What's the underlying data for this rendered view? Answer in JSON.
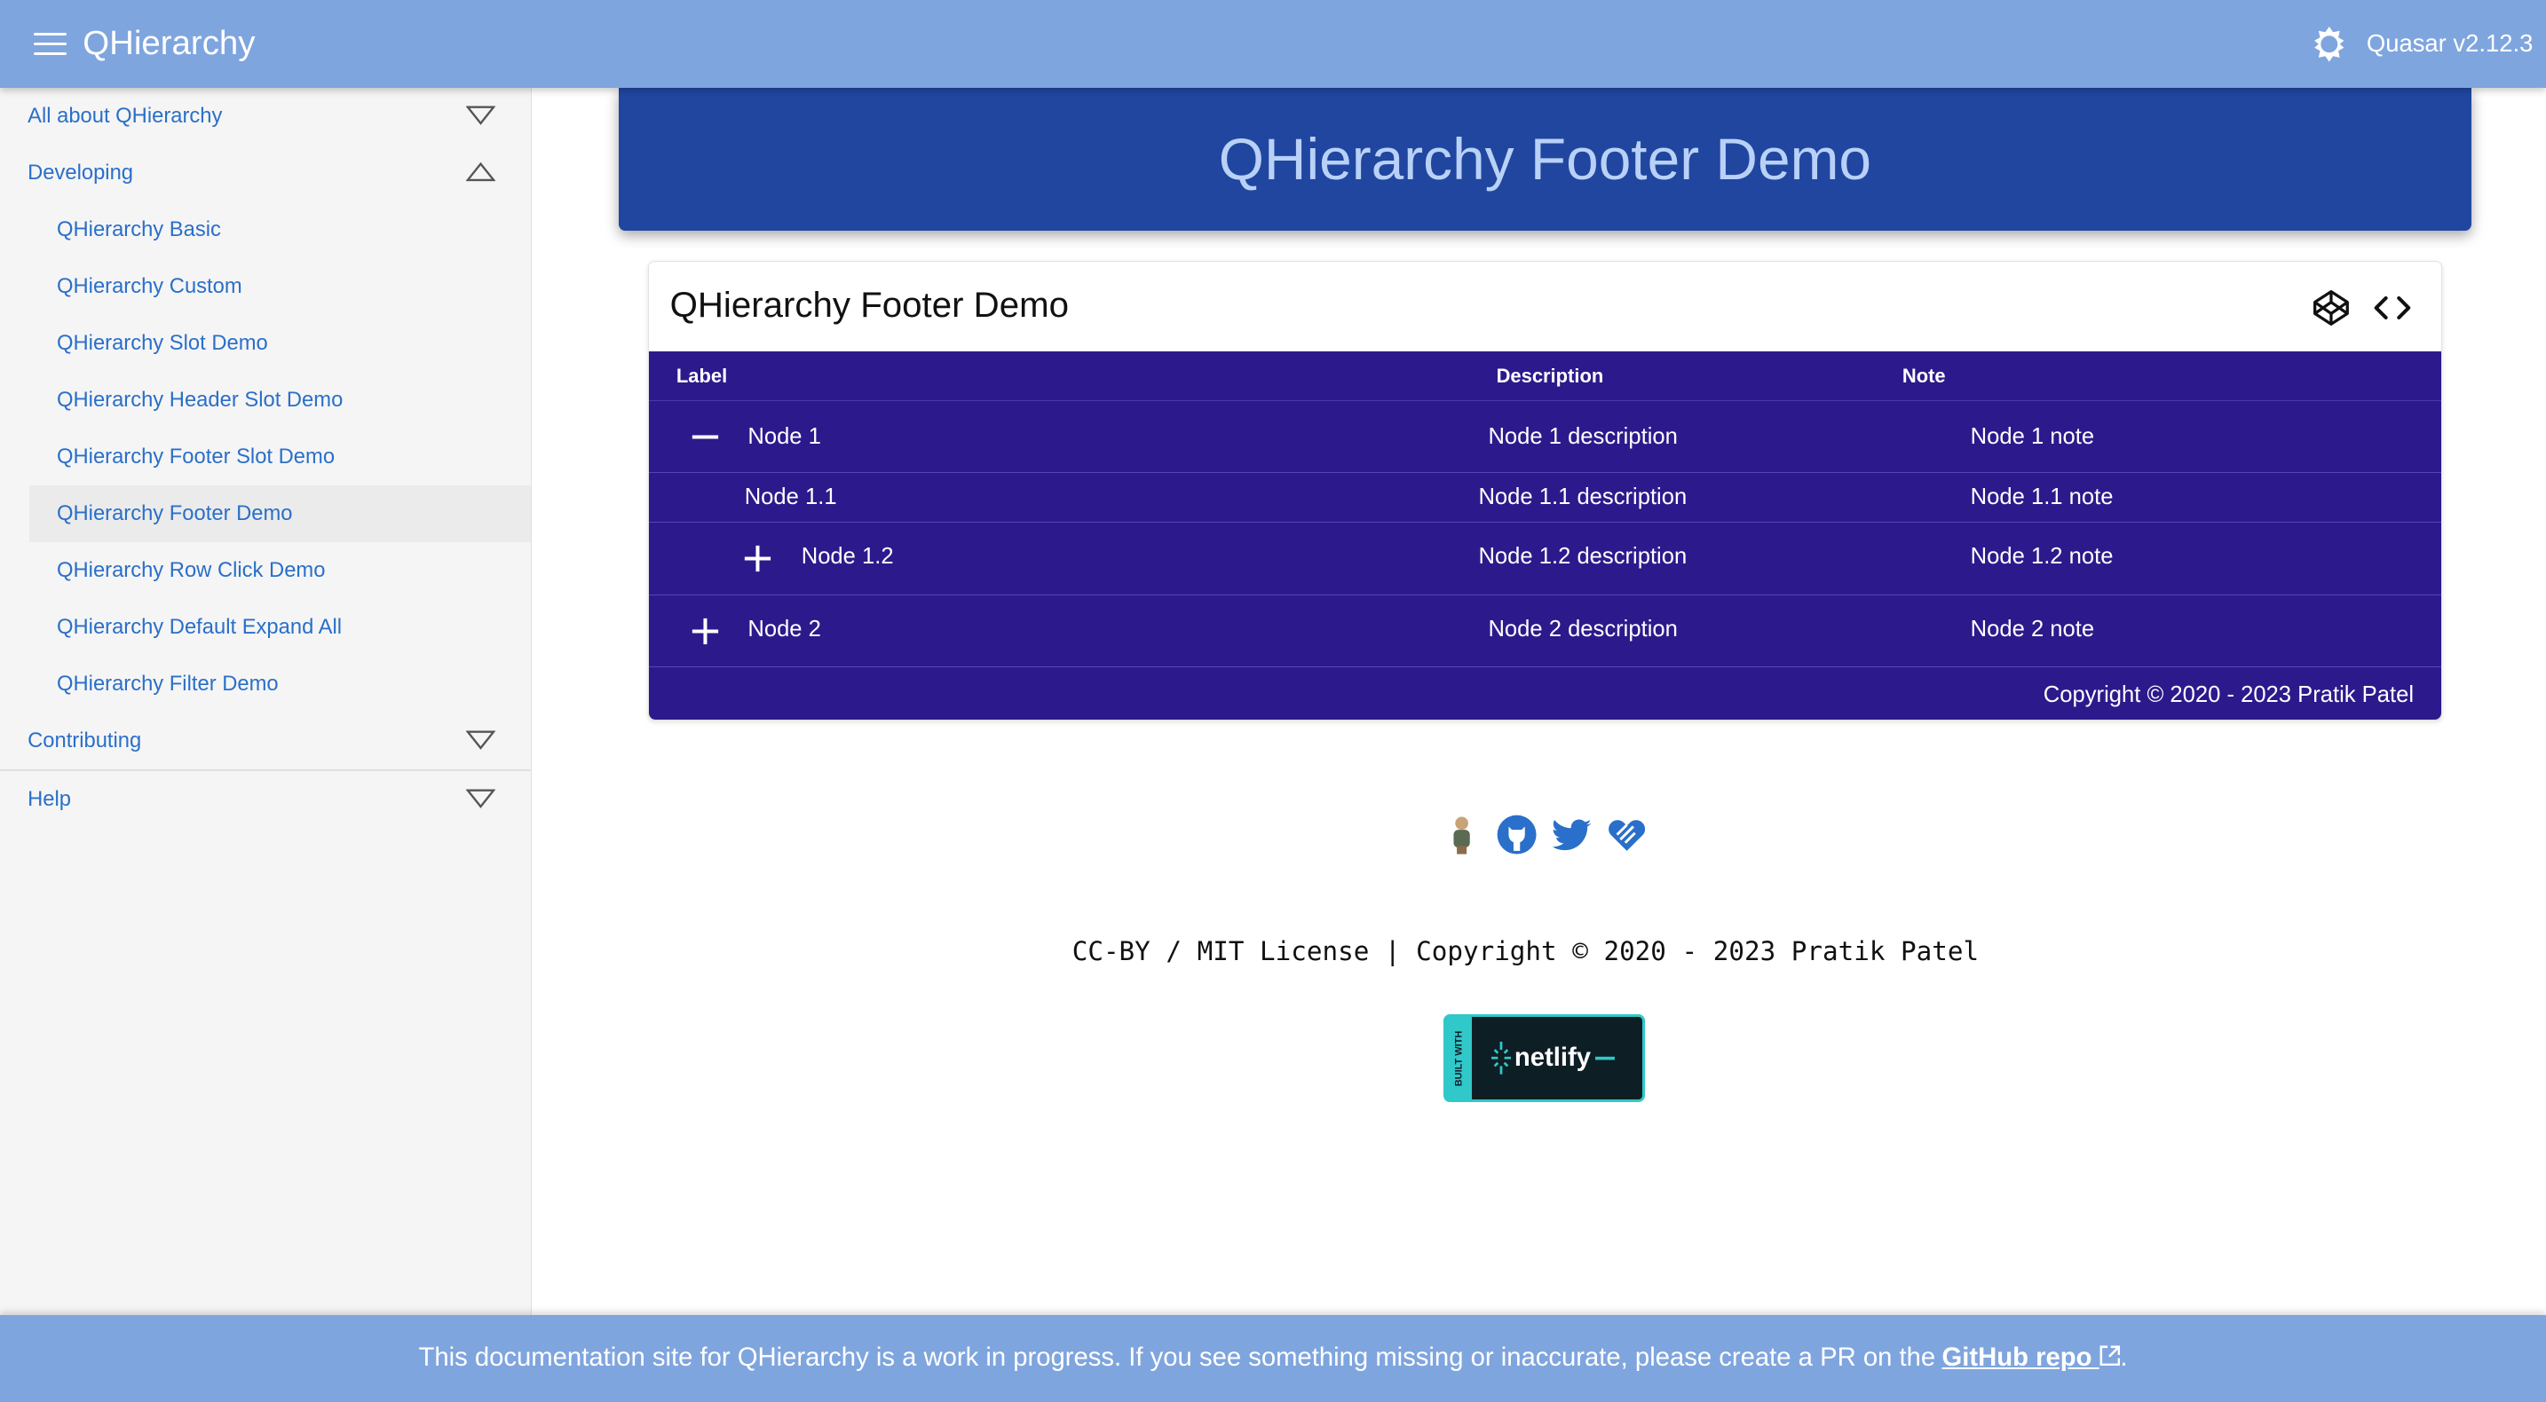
{
  "header": {
    "title": "QHierarchy",
    "version": "Quasar v2.12.3"
  },
  "sidebar": {
    "groups": [
      {
        "label": "All about QHierarchy",
        "expanded": false
      },
      {
        "label": "Developing",
        "expanded": true
      },
      {
        "label": "Contributing",
        "expanded": false
      },
      {
        "label": "Help",
        "expanded": false
      }
    ],
    "sub_items": [
      "QHierarchy Basic",
      "QHierarchy Custom",
      "QHierarchy Slot Demo",
      "QHierarchy Header Slot Demo",
      "QHierarchy Footer Slot Demo",
      "QHierarchy Footer Demo",
      "QHierarchy Row Click Demo",
      "QHierarchy Default Expand All",
      "QHierarchy Filter Demo"
    ],
    "active": "QHierarchy Footer Demo"
  },
  "banner": {
    "title": "QHierarchy Footer Demo"
  },
  "card": {
    "title": "QHierarchy Footer Demo",
    "columns": [
      "Label",
      "Description",
      "Note"
    ],
    "rows": [
      {
        "label": "Node 1",
        "description": "Node 1 description",
        "note": "Node 1 note",
        "toggle": "minus"
      },
      {
        "label": "Node 1.1",
        "description": "Node 1.1 description",
        "note": "Node 1.1 note",
        "toggle": ""
      },
      {
        "label": "Node 1.2",
        "description": "Node 1.2 description",
        "note": "Node 1.2 note",
        "toggle": "plus"
      },
      {
        "label": "Node 2",
        "description": "Node 2 description",
        "note": "Node 2 note",
        "toggle": "plus"
      }
    ],
    "footer": "Copyright © 2020 - 2023 Pratik Patel"
  },
  "footer": {
    "social_icons": [
      "avatar-icon",
      "github-icon",
      "twitter-icon",
      "sponsor-icon"
    ],
    "license": "CC-BY / MIT License | Copyright © 2020 - 2023 Pratik Patel",
    "netlify_built": "BUILT WITH",
    "netlify_word": "netlify"
  },
  "notice": {
    "text": "This documentation site for QHierarchy is a work in progress. If you see something missing or inaccurate, please create a PR on the",
    "link": "GitHub repo",
    "end": "."
  },
  "colors": {
    "topbar": "#7fa5de",
    "banner": "#2046a0",
    "table": "#2c1a8c",
    "link": "#2a6fc9"
  }
}
